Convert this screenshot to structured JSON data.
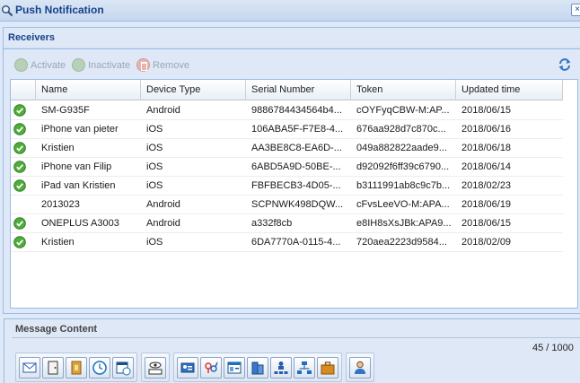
{
  "window": {
    "title": "Push Notification",
    "close_label": "×"
  },
  "receivers": {
    "section_title": "Receivers",
    "toolbar": {
      "activate_label": "Activate",
      "inactivate_label": "Inactivate",
      "remove_label": "Remove"
    },
    "columns": {
      "name": "Name",
      "device_type": "Device Type",
      "serial_number": "Serial Number",
      "token": "Token",
      "updated_time": "Updated time"
    },
    "rows": [
      {
        "active": true,
        "name": "SM-G935F",
        "device_type": "Android",
        "serial": "9886784434564b4...",
        "token": "cOYFyqCBW-M:AP...",
        "updated": "2018/06/15"
      },
      {
        "active": true,
        "name": "iPhone van pieter",
        "device_type": "iOS",
        "serial": "106ABA5F-F7E8-4...",
        "token": "676aa928d7c870c...",
        "updated": "2018/06/16"
      },
      {
        "active": true,
        "name": "Kristien",
        "device_type": "iOS",
        "serial": "AA3BE8C8-EA6D-...",
        "token": "049a882822aade9...",
        "updated": "2018/06/18"
      },
      {
        "active": true,
        "name": "iPhone van Filip",
        "device_type": "iOS",
        "serial": "6ABD5A9D-50BE-...",
        "token": "d92092f6ff39c6790...",
        "updated": "2018/06/14"
      },
      {
        "active": true,
        "name": "iPad van Kristien",
        "device_type": "iOS",
        "serial": "FBFBECB3-4D05-...",
        "token": "b3111991ab8c9c7b...",
        "updated": "2018/02/23"
      },
      {
        "active": false,
        "name": "2013023",
        "device_type": "Android",
        "serial": "SCPNWK498DQW...",
        "token": "cFvsLeeVO-M:APA...",
        "updated": "2018/06/19"
      },
      {
        "active": true,
        "name": "ONEPLUS A3003",
        "device_type": "Android",
        "serial": "a332f8cb",
        "token": "e8IH8sXsJBk:APA9...",
        "updated": "2018/06/15"
      },
      {
        "active": true,
        "name": "Kristien",
        "device_type": "iOS",
        "serial": "6DA7770A-0115-4...",
        "token": "720aea2223d9584...",
        "updated": "2018/02/09"
      }
    ]
  },
  "message": {
    "section_title": "Message Content",
    "counter": "45 / 1000",
    "toolbar_groups": [
      [
        "envelope-icon",
        "door-icon",
        "box-icon",
        "clock-icon",
        "calendar-clock-icon"
      ],
      [
        "eye-code-icon"
      ],
      [
        "contact-card-icon",
        "gender-icon",
        "id-card-icon",
        "building-icon",
        "org-chart-user-icon",
        "org-chart-icon",
        "briefcase-icon"
      ],
      [
        "user-icon"
      ]
    ]
  }
}
